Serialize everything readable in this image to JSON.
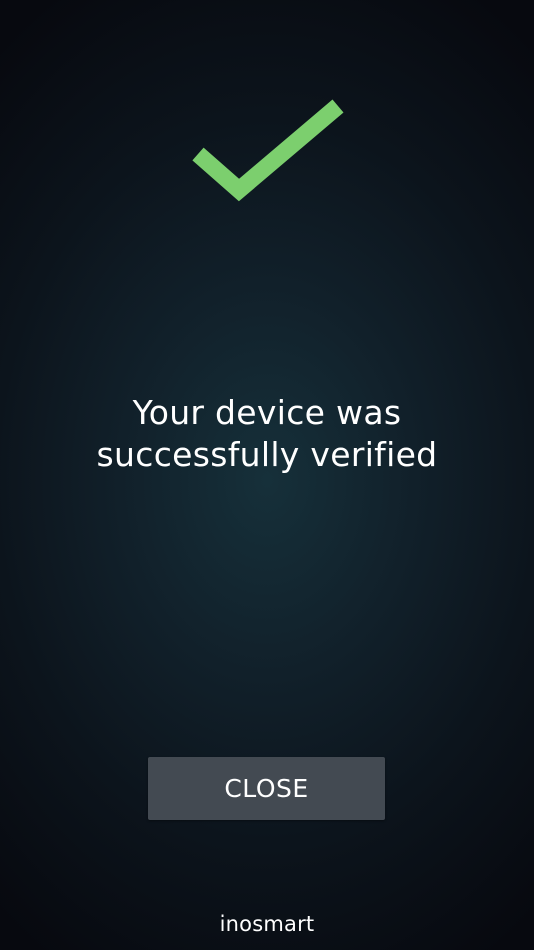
{
  "icons": {
    "success": "checkmark-icon",
    "success_color": "#7ccf6e"
  },
  "message": {
    "line1": "Your device was",
    "line2": "successfully verified"
  },
  "close_button": {
    "label": "CLOSE"
  },
  "brand": {
    "name": "inosmart"
  },
  "colors": {
    "button_bg": "#434a52",
    "text": "#ffffff"
  }
}
